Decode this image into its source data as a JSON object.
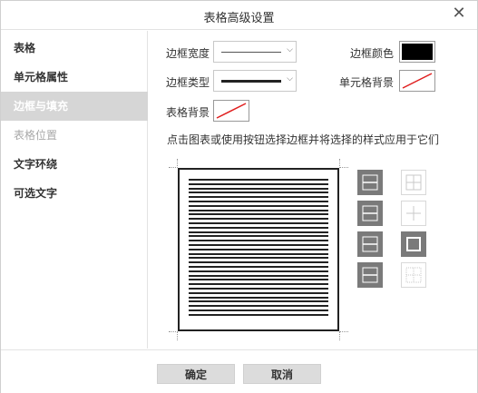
{
  "dialog": {
    "title": "表格高级设置",
    "close_glyph": "✕"
  },
  "sidebar": {
    "items": [
      {
        "label": "表格",
        "state": "normal"
      },
      {
        "label": "单元格属性",
        "state": "normal"
      },
      {
        "label": "边框与填充",
        "state": "active"
      },
      {
        "label": "表格位置",
        "state": "disabled"
      },
      {
        "label": "文字环绕",
        "state": "normal"
      },
      {
        "label": "可选文字",
        "state": "normal"
      }
    ]
  },
  "main": {
    "border_width_label": "边框宽度",
    "border_color_label": "边框颜色",
    "border_type_label": "边框类型",
    "cell_background_label": "单元格背景",
    "table_background_label": "表格背景",
    "hint": "点击图表或使用按钮选择边框并将选择的样式应用于它们",
    "chevron_glyph": "⌵"
  },
  "colors": {
    "border_color": "#000000",
    "no_fill_line": "#e02020",
    "button_active": "#7a7a7a",
    "sidebar_active": "#d6d6d6"
  },
  "border_buttons": [
    {
      "icon": "border-top-horizontal-icon",
      "state": "active"
    },
    {
      "icon": "border-all-grid-icon",
      "state": "inactive"
    },
    {
      "icon": "border-middle-horizontal-icon",
      "state": "active"
    },
    {
      "icon": "border-inner-cross-icon",
      "state": "inactive"
    },
    {
      "icon": "border-bottom-horizontal-icon",
      "state": "active"
    },
    {
      "icon": "border-outer-box-icon",
      "state": "active"
    },
    {
      "icon": "border-horizontal-all-icon",
      "state": "active"
    },
    {
      "icon": "border-none-grid-icon",
      "state": "inactive"
    }
  ],
  "footer": {
    "ok_label": "确定",
    "cancel_label": "取消"
  }
}
